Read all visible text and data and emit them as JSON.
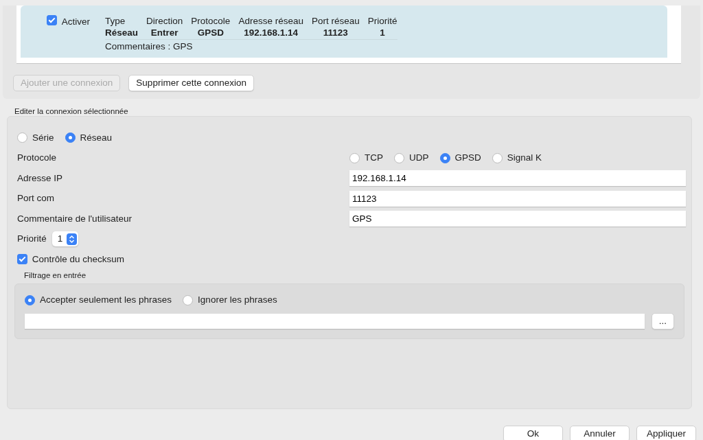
{
  "connections": [
    {
      "enabled": true,
      "enabled_label": "Activer",
      "selected": true,
      "columns": [
        {
          "header": "Type",
          "value": "Réseau"
        },
        {
          "header": "Direction",
          "value": "Entrer"
        },
        {
          "header": "Protocole",
          "value": "GPSD"
        },
        {
          "header": "Adresse réseau",
          "value": "192.168.1.14"
        },
        {
          "header": "Port réseau",
          "value": "11123"
        },
        {
          "header": "Priorité",
          "value": "1"
        }
      ],
      "comment": "Commentaires : GPS"
    }
  ],
  "list_buttons": [
    {
      "label": "Ajouter une connexion",
      "disabled": true
    },
    {
      "label": "Supprimer cette connexion",
      "disabled": false
    }
  ],
  "edit_section": {
    "title": "Editer la connexion sélectionnée",
    "connection_types": [
      {
        "label": "Série",
        "selected": false
      },
      {
        "label": "Réseau",
        "selected": true
      }
    ],
    "fields": [
      {
        "kind": "radio",
        "label": "Protocole",
        "options": [
          {
            "label": "TCP",
            "selected": false
          },
          {
            "label": "UDP",
            "selected": false
          },
          {
            "label": "GPSD",
            "selected": true
          },
          {
            "label": "Signal K",
            "selected": false
          }
        ]
      },
      {
        "kind": "text",
        "label": "Adresse IP",
        "value": "192.168.1.14"
      },
      {
        "kind": "text",
        "label": "Port com",
        "value": "11123"
      },
      {
        "kind": "text",
        "label": "Commentaire de l'utilisateur",
        "value": "GPS"
      }
    ],
    "priority": {
      "label": "Priorité",
      "value": "1"
    },
    "checksum": {
      "label": "Contrôle du checksum",
      "checked": true
    },
    "filter": {
      "title": "Filtrage en entrée",
      "modes": [
        {
          "label": "Accepter seulement les phrases",
          "selected": true
        },
        {
          "label": "Ignorer les phrases",
          "selected": false
        }
      ],
      "more_button": "..."
    }
  },
  "buttons": [
    "Ok",
    "Annuler",
    "Appliquer"
  ]
}
